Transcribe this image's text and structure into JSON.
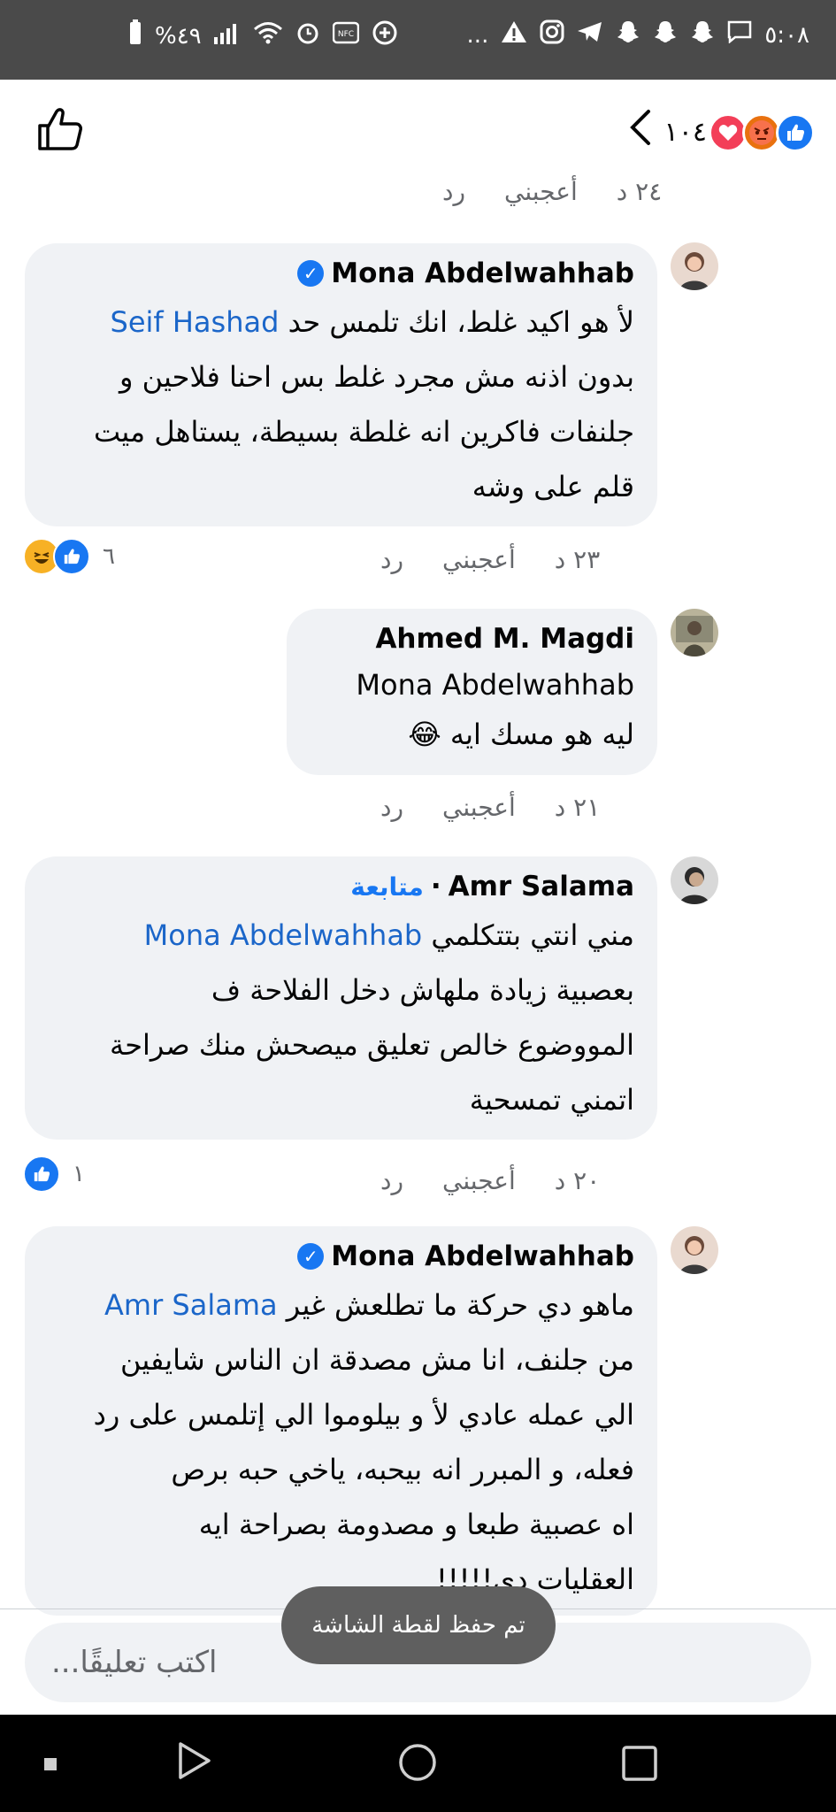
{
  "status_bar": {
    "time": "٥:٠٨",
    "battery": "%٤٩",
    "more": "..."
  },
  "header": {
    "reaction_count": "١٠٤",
    "reaction_icons": [
      "like-icon",
      "angry-icon",
      "love-icon"
    ],
    "like_button_icon": "thumbs-up-outline-icon"
  },
  "top_meta": {
    "time": "٢٤ د",
    "like": "أعجبني",
    "reply": "رد"
  },
  "comments": [
    {
      "author": "Mona Abdelwahhab",
      "verified": true,
      "mention": "Seif Hashad",
      "lines": [
        "لأ هو اكيد غلط، انك تلمس حد",
        "بدون اذنه مش مجرد غلط بس احنا فلاحين و",
        "جلنفات فاكرين انه غلطة بسيطة، يستاهل ميت",
        "قلم على وشه"
      ],
      "time": "٢٣ د",
      "like": "أعجبني",
      "reply": "رد",
      "reactions_count": "٦"
    },
    {
      "author": "Ahmed M. Magdi",
      "verified": false,
      "mention": "Mona Abdelwahhab",
      "lines": [
        "ليه هو مسك ايه"
      ],
      "emoji": "😂",
      "time": "٢١ د",
      "like": "أعجبني",
      "reply": "رد"
    },
    {
      "author": "Amr Salama",
      "verified": false,
      "follow": "متابعة",
      "dot": "·",
      "mention": "Mona Abdelwahhab",
      "lines": [
        "مني انتي بتتكلمي",
        "بعصبية زيادة ملهاش دخل الفلاحة ف",
        "المووضوع خالص تعليق ميصحش منك صراحة",
        "اتمني تمسحية"
      ],
      "time": "٢٠ د",
      "like": "أعجبني",
      "reply": "رد",
      "reactions_count": "١"
    },
    {
      "author": "Mona Abdelwahhab",
      "verified": true,
      "mention": "Amr Salama",
      "lines": [
        "ماهو دي حركة ما تطلعش غير",
        "من جلنف، انا مش مصدقة ان الناس شايفين",
        "الي عمله عادي لأ و بيلوموا الي إتلمس على رد",
        "فعله، و المبرر انه بيحبه، ياخي حبه برص",
        "اه عصبية طبعا و مصدومة بصراحة ايه",
        "العقليات دي!!!!!"
      ]
    }
  ],
  "composer": {
    "placeholder": "اكتب تعليقًا..."
  },
  "toast": {
    "text": "تم حفظ لقطة الشاشة"
  },
  "colors": {
    "accent": "#1877f2",
    "bubble": "#f0f2f5",
    "meta": "#65676b"
  }
}
